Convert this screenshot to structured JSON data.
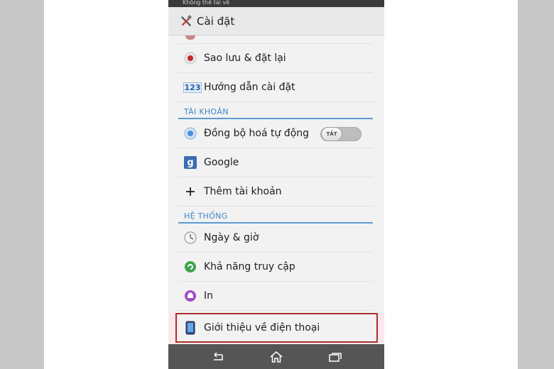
{
  "statusbar": {
    "text": "Không thể tải về"
  },
  "actionbar": {
    "title": "Cài đặt",
    "icon": "tools-icon"
  },
  "sections": {
    "accounts": "TÀI KHOẢN",
    "system": "HỆ THỐNG"
  },
  "items": {
    "backup": "Sao lưu & đặt lại",
    "setup_guide": "Hướng dẫn cài đặt",
    "auto_sync": "Đồng bộ hoá tự động",
    "google": "Google",
    "add_account": "Thêm tài khoản",
    "date_time": "Ngày & giờ",
    "accessibility": "Khả năng truy cập",
    "print": "In",
    "about_phone": "Giới thiệu về điện thoại"
  },
  "toggle": {
    "auto_sync_state": "TẮT"
  },
  "icons": {
    "setup_guide_glyph": "123",
    "google_glyph": "g"
  },
  "colors": {
    "section_accent": "#3f86c8",
    "highlight": "#a8322e",
    "navbar": "#555555"
  }
}
